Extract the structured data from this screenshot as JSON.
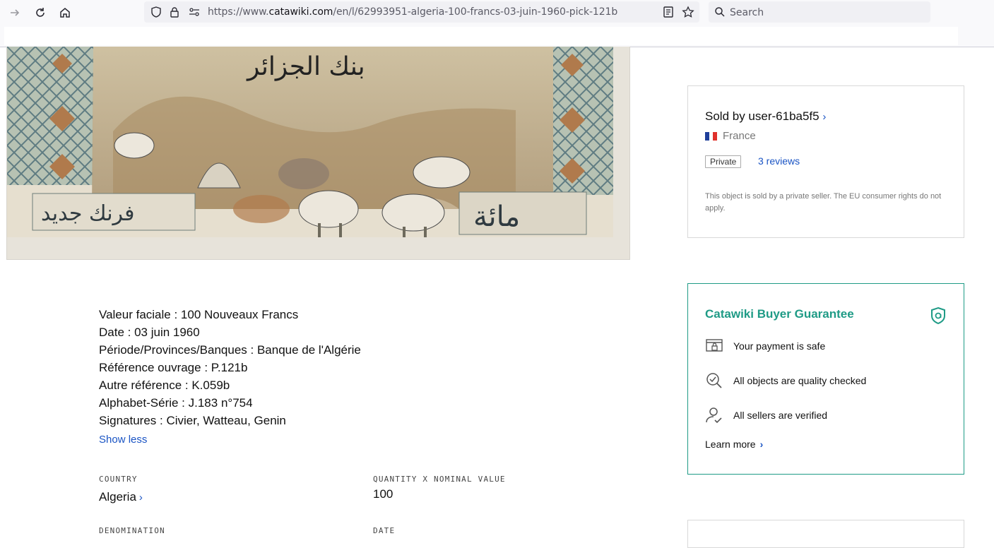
{
  "browser": {
    "url_prefix": "https://www.",
    "url_domain": "catawiki.com",
    "url_path": "/en/l/62993951-algeria-100-francs-03-juin-1960-pick-121b",
    "search_placeholder": "Search"
  },
  "image": {
    "script_top": "بنك الجزائر",
    "script_bottom_left": "فرنك جديد",
    "script_bottom_right": "مائة"
  },
  "seller": {
    "name": "Sold by user-61ba5f5",
    "chevron": "›",
    "country": "France",
    "badge": "Private",
    "reviews": "3 reviews",
    "notice": "This object is sold by a private seller. The EU consumer rights do not apply."
  },
  "guarantee": {
    "title": "Catawiki Buyer Guarantee",
    "items": [
      {
        "label": "Your payment is safe",
        "icon": "payment-safe-icon"
      },
      {
        "label": "All objects are quality checked",
        "icon": "quality-check-icon"
      },
      {
        "label": "All sellers are verified",
        "icon": "verified-seller-icon"
      }
    ],
    "learn_more": "Learn more",
    "accent": "#1f9b86"
  },
  "description": {
    "lines": [
      "Valeur faciale : 100 Nouveaux Francs",
      "Date : 03 juin 1960",
      "Période/Provinces/Banques : Banque de l'Algérie",
      "Référence ouvrage : P.121b",
      "Autre référence : K.059b",
      "Alphabet-Série : J.183 n°754",
      "Signatures : Civier, Watteau, Genin"
    ],
    "show_less": "Show less"
  },
  "specs": {
    "country_label": "COUNTRY",
    "country_value": "Algeria",
    "quantity_label": "QUANTITY X NOMINAL VALUE",
    "quantity_value": "100",
    "denomination_label": "DENOMINATION",
    "date_label": "DATE"
  },
  "colors": {
    "link": "#1a54c4",
    "accent": "#1f9b86"
  }
}
